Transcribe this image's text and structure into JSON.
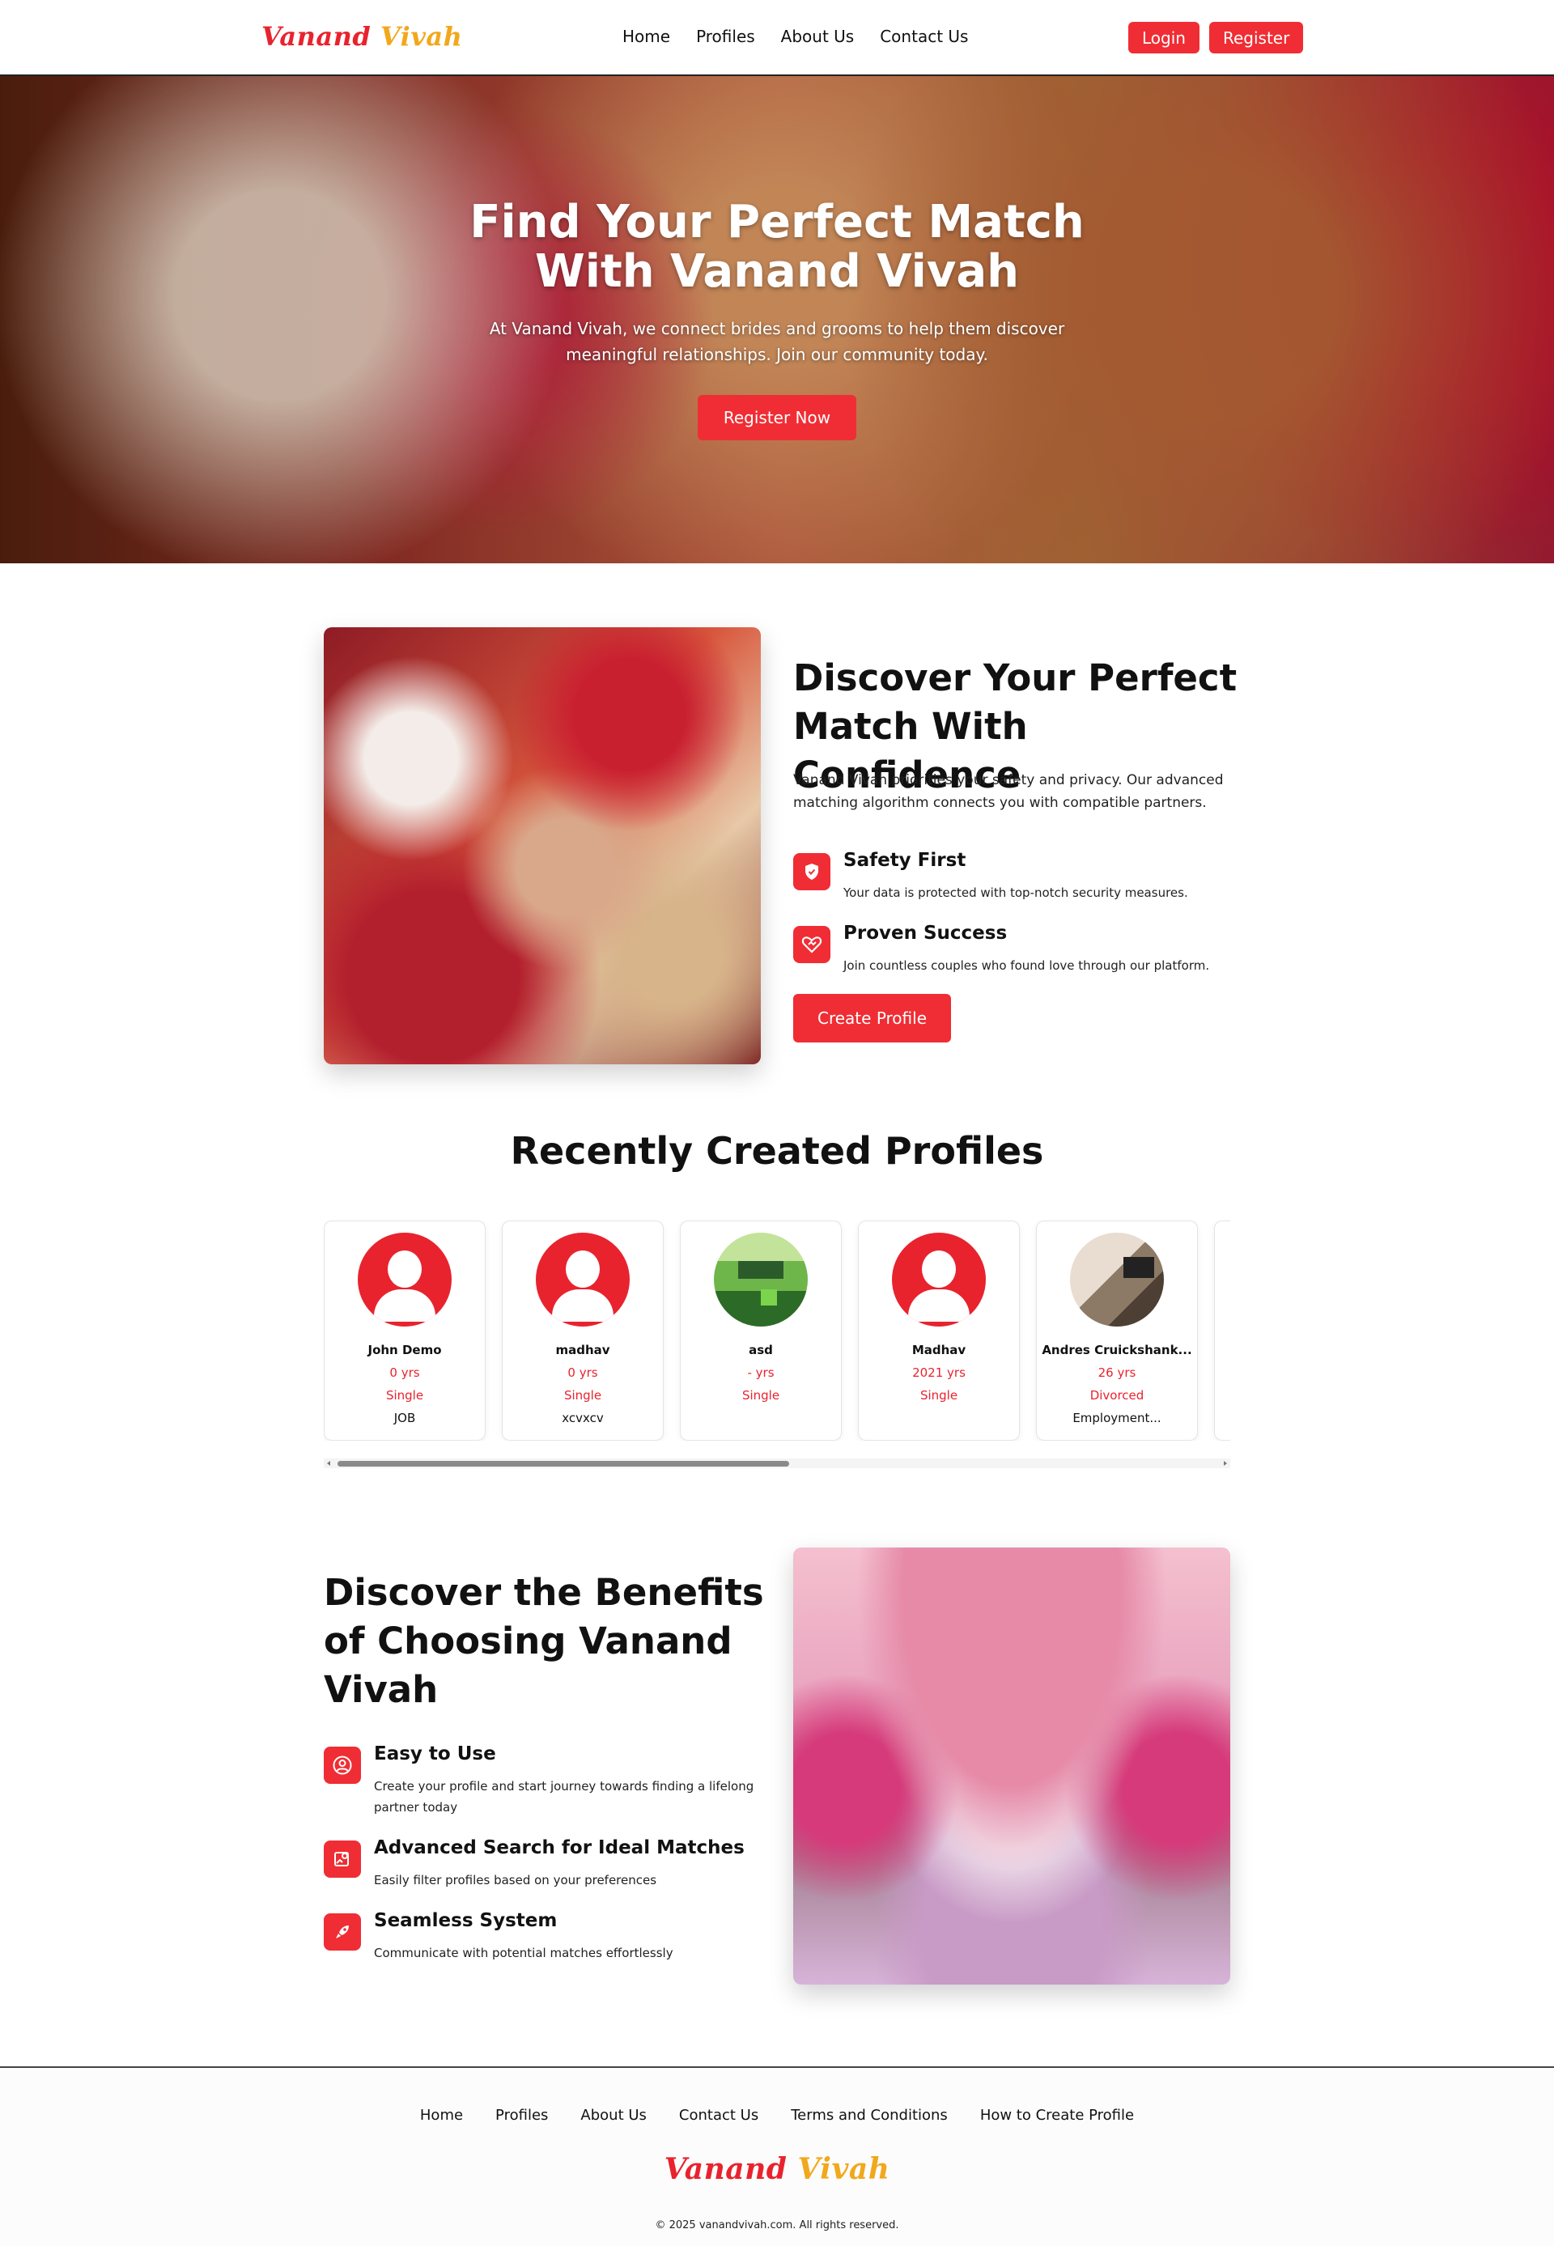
{
  "nav": {
    "logo_part1": "Vanand",
    "logo_part2": "Vivah",
    "links": [
      "Home",
      "Profiles",
      "About Us",
      "Contact Us"
    ],
    "login_label": "Login",
    "register_label": "Register"
  },
  "hero": {
    "title_line1": "Find Your Perfect Match",
    "title_line2": "With Vanand Vivah",
    "subtitle": "At Vanand Vivah, we connect brides and grooms to help them discover meaningful relationships. Join our community today.",
    "cta": "Register Now"
  },
  "intro": {
    "title": "Discover Your Perfect Match With Confidence",
    "description": "Vanand Vivah priorities your safety and privacy. Our advanced matching algorithm connects you with compatible partners.",
    "features": [
      {
        "title": "Safety First",
        "desc": "Your data is protected with top-notch security measures.",
        "icon": "shield-check-icon"
      },
      {
        "title": "Proven Success",
        "desc": "Join countless couples who found love through our platform.",
        "icon": "heart-handshake-icon"
      }
    ],
    "cta": "Create Profile"
  },
  "profiles": {
    "title": "Recently Created Profiles",
    "cards": [
      {
        "name": "John Demo",
        "age": "0 yrs",
        "status": "Single",
        "job": "JOB",
        "avatar": "default"
      },
      {
        "name": "madhav",
        "age": "0 yrs",
        "status": "Single",
        "job": "xcvxcv",
        "avatar": "default"
      },
      {
        "name": "asd",
        "age": "- yrs",
        "status": "Single",
        "job": "",
        "avatar": "pixel"
      },
      {
        "name": "Madhav",
        "age": "2021 yrs",
        "status": "Single",
        "job": "",
        "avatar": "default"
      },
      {
        "name": "Andres Cruickshank...",
        "age": "26 yrs",
        "status": "Divorced",
        "job": "Employment...",
        "avatar": "room"
      }
    ]
  },
  "benefits": {
    "title": "Discover the Benefits of Choosing Vanand Vivah",
    "items": [
      {
        "title": "Easy to Use",
        "desc": "Create your profile and start journey towards finding a lifelong partner today",
        "icon": "user-circle-icon"
      },
      {
        "title": "Advanced Search for Ideal Matches",
        "desc": "Easily filter profiles based on your preferences",
        "icon": "image-search-icon"
      },
      {
        "title": "Seamless System",
        "desc": "Communicate with potential matches effortlessly",
        "icon": "rocket-icon"
      }
    ]
  },
  "footer": {
    "links": [
      "Home",
      "Profiles",
      "About Us",
      "Contact Us",
      "Terms and Conditions",
      "How to Create Profile"
    ],
    "logo_part1": "Vanand",
    "logo_part2": "Vivah",
    "copyright": "© 2025 vanandvivah.com. All rights reserved."
  },
  "colors": {
    "accent": "#f02d34",
    "logo_red": "#e8232e",
    "logo_gold": "#f1a81c"
  }
}
